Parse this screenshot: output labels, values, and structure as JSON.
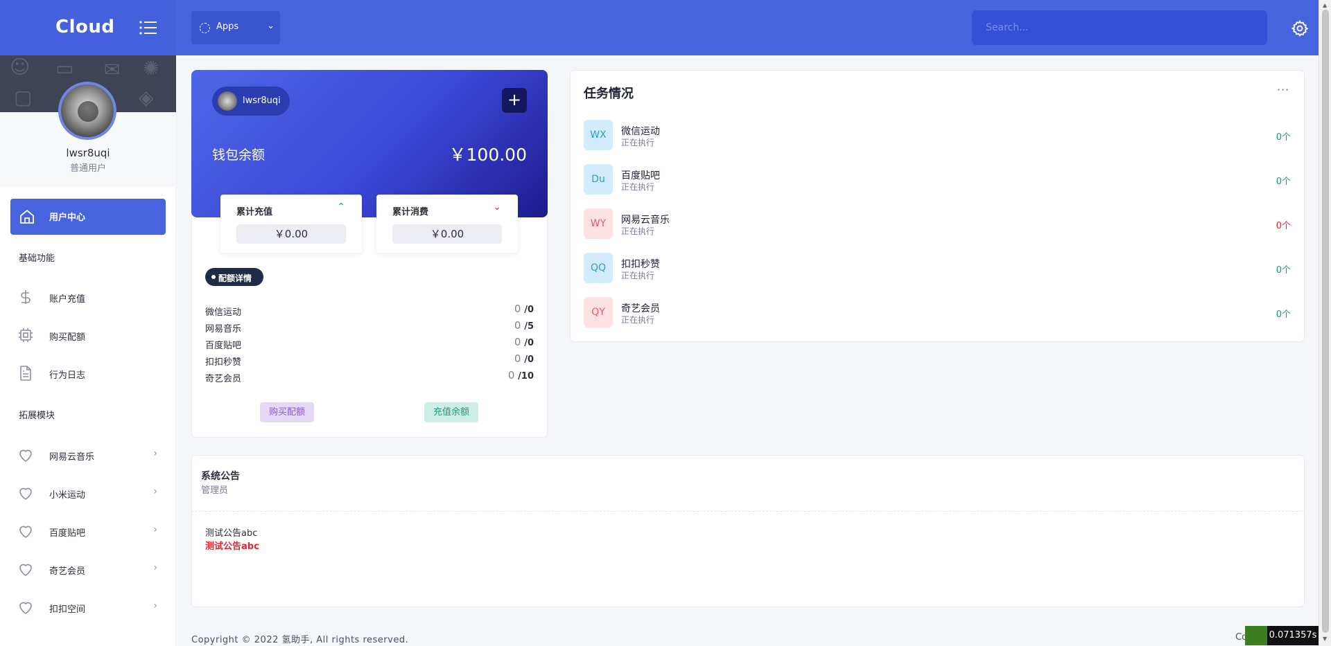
{
  "header": {
    "brand": "Cloud",
    "apps_label": "Apps",
    "search_placeholder": "Search..."
  },
  "sidebar": {
    "user_name": "lwsr8uqi",
    "user_role": "普通用户",
    "active_item": "用户中心",
    "section_basic": "基础功能",
    "basic_items": [
      {
        "label": "账户充值",
        "icon": "dollar-icon"
      },
      {
        "label": "购买配额",
        "icon": "cpu-icon"
      },
      {
        "label": "行为日志",
        "icon": "file-icon"
      }
    ],
    "section_ext": "拓展模块",
    "ext_items": [
      {
        "label": "网易云音乐",
        "icon": "heart-icon"
      },
      {
        "label": "小米运动",
        "icon": "heart-icon"
      },
      {
        "label": "百度贴吧",
        "icon": "heart-icon"
      },
      {
        "label": "奇艺会员",
        "icon": "heart-icon"
      },
      {
        "label": "扣扣空间",
        "icon": "heart-icon"
      }
    ]
  },
  "wallet": {
    "user": "lwsr8uqi",
    "label": "钱包余额",
    "amount": "￥100.00",
    "recharge_title": "累计充值",
    "recharge_value": "￥0.00",
    "consume_title": "累计消费",
    "consume_value": "￥0.00",
    "quota_label": "配额详情",
    "quotas": [
      {
        "name": "微信运动",
        "used": "0",
        "total": "/0"
      },
      {
        "name": "网易音乐",
        "used": "0",
        "total": "/5"
      },
      {
        "name": "百度贴吧",
        "used": "0",
        "total": "/0"
      },
      {
        "name": "扣扣秒赞",
        "used": "0",
        "total": "/0"
      },
      {
        "name": "奇艺会员",
        "used": "0",
        "total": "/10"
      }
    ],
    "buy_label": "购买配额",
    "recharge_label": "充值余额"
  },
  "tasks": {
    "title": "任务情况",
    "items": [
      {
        "badge": "WX",
        "name": "微信运动",
        "status": "正在执行",
        "count": "0个",
        "color": "#1b9b7a",
        "bg": "#d3ecfb",
        "fg": "#2e9ad6"
      },
      {
        "badge": "Du",
        "name": "百度贴吧",
        "status": "正在执行",
        "count": "0个",
        "color": "#1b9b7a",
        "bg": "#d3ecfb",
        "fg": "#2e9ad6"
      },
      {
        "badge": "WY",
        "name": "网易云音乐",
        "status": "正在执行",
        "count": "0个",
        "color": "#e8242f",
        "bg": "#fde2e4",
        "fg": "#e65a63"
      },
      {
        "badge": "QQ",
        "name": "扣扣秒赞",
        "status": "正在执行",
        "count": "0个",
        "color": "#1b9b7a",
        "bg": "#d3ecfb",
        "fg": "#2e9ad6"
      },
      {
        "badge": "QY",
        "name": "奇艺会员",
        "status": "正在执行",
        "count": "0个",
        "color": "#1b9b7a",
        "bg": "#fde2e4",
        "fg": "#e65a63"
      }
    ]
  },
  "notice": {
    "title": "系统公告",
    "author": "管理员",
    "line1": "测试公告abc",
    "line2": "测试公告abc"
  },
  "footer": {
    "copyright": "Copyright © 2022 氢助手, All rights reserved.",
    "right": "Copy",
    "timer": "0.071357s"
  },
  "colors": {
    "primary": "#4763de",
    "dark": "#1f2a44"
  }
}
